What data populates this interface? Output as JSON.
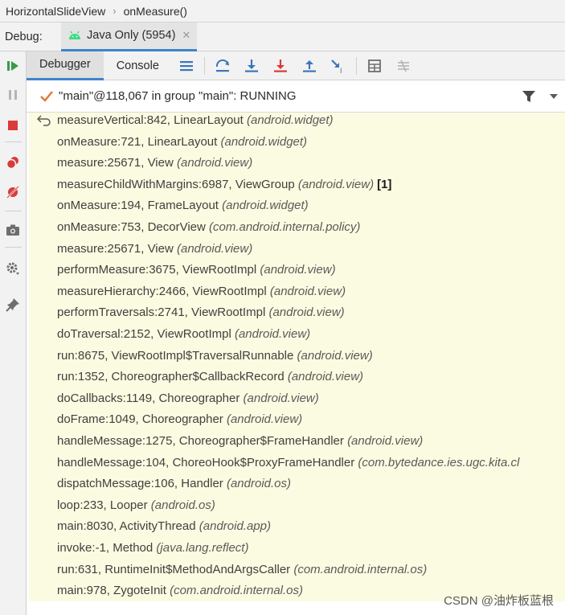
{
  "breadcrumb": {
    "items": [
      "HorizontalSlideView",
      "onMeasure()"
    ]
  },
  "debug_bar": {
    "label": "Debug:",
    "session_tab": "Java Only (5954)"
  },
  "toolbar": {
    "tabs": [
      "Debugger",
      "Console"
    ]
  },
  "thread": {
    "text": "\"main\"@118,067 in group \"main\": RUNNING"
  },
  "frames": [
    {
      "method": "measureVertical:842, LinearLayout",
      "package": "(android.widget)"
    },
    {
      "method": "onMeasure:721, LinearLayout",
      "package": "(android.widget)"
    },
    {
      "method": "measure:25671, View",
      "package": "(android.view)"
    },
    {
      "method": "measureChildWithMargins:6987, ViewGroup",
      "package": "(android.view)",
      "badge": "[1]"
    },
    {
      "method": "onMeasure:194, FrameLayout",
      "package": "(android.widget)"
    },
    {
      "method": "onMeasure:753, DecorView",
      "package": "(com.android.internal.policy)"
    },
    {
      "method": "measure:25671, View",
      "package": "(android.view)"
    },
    {
      "method": "performMeasure:3675, ViewRootImpl",
      "package": "(android.view)"
    },
    {
      "method": "measureHierarchy:2466, ViewRootImpl",
      "package": "(android.view)"
    },
    {
      "method": "performTraversals:2741, ViewRootImpl",
      "package": "(android.view)"
    },
    {
      "method": "doTraversal:2152, ViewRootImpl",
      "package": "(android.view)"
    },
    {
      "method": "run:8675, ViewRootImpl$TraversalRunnable",
      "package": "(android.view)"
    },
    {
      "method": "run:1352, Choreographer$CallbackRecord",
      "package": "(android.view)"
    },
    {
      "method": "doCallbacks:1149, Choreographer",
      "package": "(android.view)"
    },
    {
      "method": "doFrame:1049, Choreographer",
      "package": "(android.view)"
    },
    {
      "method": "handleMessage:1275, Choreographer$FrameHandler",
      "package": "(android.view)"
    },
    {
      "method": "handleMessage:104, ChoreoHook$ProxyFrameHandler",
      "package": "(com.bytedance.ies.ugc.kita.cl"
    },
    {
      "method": "dispatchMessage:106, Handler",
      "package": "(android.os)"
    },
    {
      "method": "loop:233, Looper",
      "package": "(android.os)"
    },
    {
      "method": "main:8030, ActivityThread",
      "package": "(android.app)"
    },
    {
      "method": "invoke:-1, Method",
      "package": "(java.lang.reflect)"
    },
    {
      "method": "run:631, RuntimeInit$MethodAndArgsCaller",
      "package": "(com.android.internal.os)"
    },
    {
      "method": "main:978, ZygoteInit",
      "package": "(com.android.internal.os)"
    }
  ],
  "watermark": "CSDN @油炸板蓝根",
  "icons": {
    "resume": "resume-icon",
    "pause": "pause-icon",
    "stop": "stop-icon",
    "breakpoints": "view-breakpoints-icon",
    "mute": "mute-breakpoints-icon",
    "camera": "camera-icon",
    "settings": "settings-icon",
    "pin": "pin-icon",
    "android": "android-icon",
    "menu": "menu-icon",
    "step_over": "step-over-icon",
    "step_into": "step-into-icon",
    "force_step_into": "force-step-into-icon",
    "step_out": "step-out-icon",
    "run_to_cursor": "run-to-cursor-icon",
    "evaluate": "evaluate-icon",
    "trace": "trace-icon",
    "check": "check-icon",
    "filter": "filter-icon",
    "dropdown": "chevron-down-icon",
    "return": "return-icon"
  },
  "colors": {
    "accent": "#4083c9",
    "frames_bg": "#fbfbe1",
    "green": "#3a9a4a",
    "red": "#d93a3a"
  }
}
